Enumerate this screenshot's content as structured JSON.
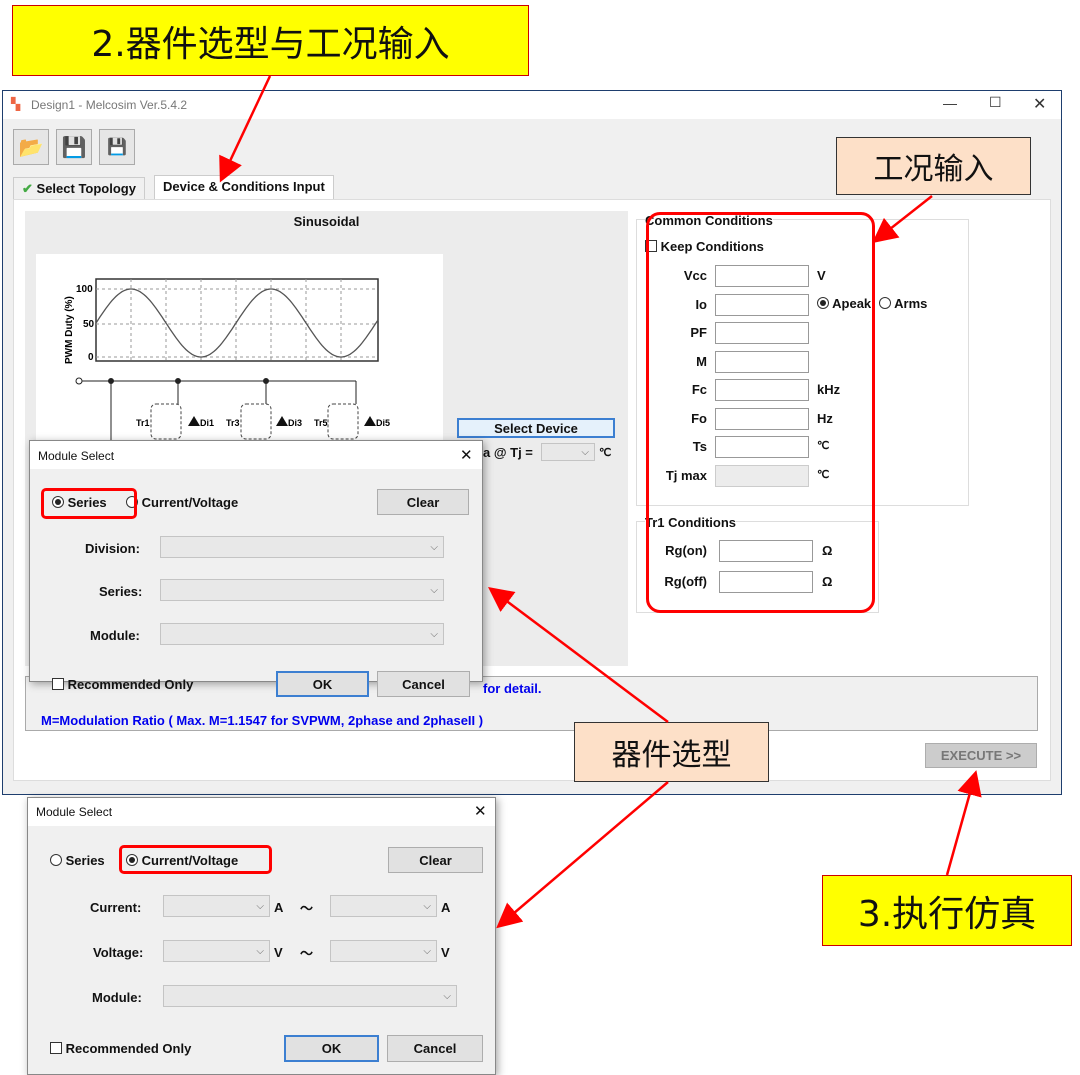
{
  "window": {
    "title": "Design1 - Melcosim Ver.5.4.2"
  },
  "tabs": [
    {
      "label": "Select Topology",
      "checked": true
    },
    {
      "label": "Device & Conditions Input"
    }
  ],
  "diagram": {
    "title": "Sinusoidal",
    "ylabel": "PWM Duty (%)",
    "yticks": [
      "100",
      "50",
      "0"
    ],
    "devices": [
      "Tr1",
      "Di1",
      "Tr3",
      "Di3",
      "Tr5",
      "Di5"
    ]
  },
  "select_device": {
    "label": "Select Device",
    "tj_label": "a @ Tj =",
    "unit": "℃"
  },
  "common": {
    "title": "Common Conditions",
    "keep": "Keep Conditions",
    "rows": [
      {
        "label": "Vcc",
        "unit": "V"
      },
      {
        "label": "Io",
        "unit": ""
      },
      {
        "label": "PF",
        "unit": ""
      },
      {
        "label": "M",
        "unit": ""
      },
      {
        "label": "Fc",
        "unit": "kHz"
      },
      {
        "label": "Fo",
        "unit": "Hz"
      },
      {
        "label": "Ts",
        "unit": "℃"
      },
      {
        "label": "Tj max",
        "unit": "℃"
      }
    ],
    "apeak": "Apeak",
    "arms": "Arms"
  },
  "tr1": {
    "title": "Tr1 Conditions",
    "rows": [
      {
        "label": "Rg(on)",
        "unit": "Ω"
      },
      {
        "label": "Rg(off)",
        "unit": "Ω"
      }
    ]
  },
  "notes": {
    "line1": "for detail.",
    "line2": "M=Modulation Ratio ( Max. M=1.1547 for SVPWM, 2phase and 2phaseII )"
  },
  "execute": "EXECUTE >>",
  "dialog1": {
    "title": "Module Select",
    "series": "Series",
    "cv": "Current/Voltage",
    "clear": "Clear",
    "division": "Division:",
    "series_lbl": "Series:",
    "module": "Module:",
    "recommended": "Recommended Only",
    "ok": "OK",
    "cancel": "Cancel"
  },
  "dialog2": {
    "title": "Module Select",
    "series": "Series",
    "cv": "Current/Voltage",
    "clear": "Clear",
    "current": "Current:",
    "voltage": "Voltage:",
    "a": "A",
    "v": "V",
    "tilde": "～",
    "module": "Module:",
    "recommended": "Recommended Only",
    "ok": "OK",
    "cancel": "Cancel"
  },
  "annotations": {
    "step2": "2.器件选型与工况输入",
    "conditions": "工况输入",
    "device": "器件选型",
    "step3": "3.执行仿真"
  },
  "colors": {
    "annotation_yellow": "#ffff00",
    "annotation_peach": "#fde0c8",
    "highlight_red": "#ff0000",
    "note_blue": "#0000ee"
  }
}
